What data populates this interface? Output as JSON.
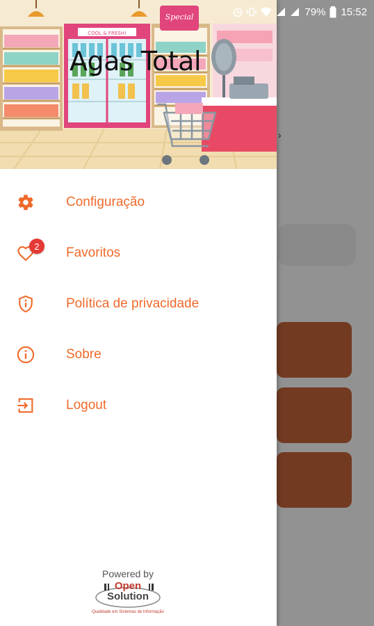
{
  "status_bar": {
    "battery": "79%",
    "time": "15:52",
    "icons": [
      "alarm-icon",
      "vibrate-icon",
      "wifi-icon",
      "signal-icon",
      "signal-icon",
      "battery-icon"
    ]
  },
  "drawer": {
    "header": {
      "title": "Agas Total",
      "illustration_labels": {
        "fridge_sign": "COOL & FRESH!",
        "sale_sign": "Special"
      }
    },
    "menu": [
      {
        "label": "Configuração",
        "icon": "gear-icon"
      },
      {
        "label": "Favoritos",
        "icon": "heart-icon",
        "badge": "2"
      },
      {
        "label": "Política de privacidade",
        "icon": "shield-info-icon"
      },
      {
        "label": "Sobre",
        "icon": "info-icon"
      },
      {
        "label": "Logout",
        "icon": "logout-icon"
      }
    ],
    "footer": {
      "powered_by": "Powered by",
      "logo_line1": "Open",
      "logo_line2": "Solution",
      "tagline": "Qualidade em Sistemas de Informação"
    }
  },
  "colors": {
    "accent": "#ef6a2a",
    "badge": "#e53935",
    "background_button": "#c0623a"
  }
}
